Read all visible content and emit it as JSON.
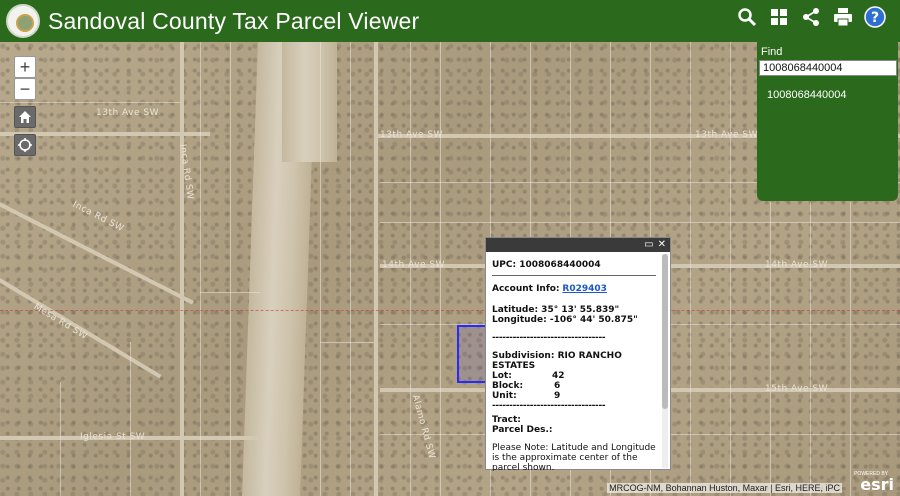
{
  "header": {
    "title": "Sandoval County Tax Parcel Viewer",
    "tools": [
      {
        "name": "search-icon"
      },
      {
        "name": "basemap-gallery-icon"
      },
      {
        "name": "share-icon"
      },
      {
        "name": "print-icon"
      },
      {
        "name": "help-icon"
      }
    ]
  },
  "colors": {
    "header_bg": "#2b6a1c",
    "parcel_outline": "#2a2aff",
    "link": "#1a57c9"
  },
  "map": {
    "controls": {
      "zoom_in": "+",
      "zoom_out": "−"
    },
    "road_labels": {
      "ave13_left": "13th Ave SW",
      "ave13_mid": "13th Ave SW",
      "ave13_right": "13th Ave SW",
      "ave14_mid": "14th Ave SW",
      "ave14_right": "14th Ave SW",
      "ave15_right": "15th Ave SW",
      "rd_nw": "Inca Rd SW",
      "rd_ne": "Inca Rd SW",
      "rd_w": "Mesa Rd SW",
      "st_sw": "Iglesia St SW",
      "rd_s": "Alamo Rd SW"
    },
    "attribution": "MRCOG-NM, Bohannan Huston, Maxar | Esri, HERE, iPC",
    "powered_by": "POWERED BY",
    "esri": "esri"
  },
  "find": {
    "label": "Find",
    "value": "1008068440004",
    "result": "1008068440004"
  },
  "popup": {
    "upc": "UPC: 1008068440004",
    "account_label": "Account Info:",
    "account_link": "R029403",
    "latitude": "Latitude: 35° 13' 55.839\"",
    "longitude": "Longitude: -106° 44' 50.875\"",
    "separator": "---------------------------------",
    "subdivision": "Subdivision: RIO RANCHO ESTATES",
    "lot_label": "Lot:",
    "lot": "42",
    "block_label": "Block:",
    "block": "6",
    "unit_label": "Unit:",
    "unit": "9",
    "tract": "Tract:",
    "parcel_des": "Parcel Des.:",
    "note": "Please Note: Latitude and Longitude is the approximate center of the parcel shown."
  }
}
